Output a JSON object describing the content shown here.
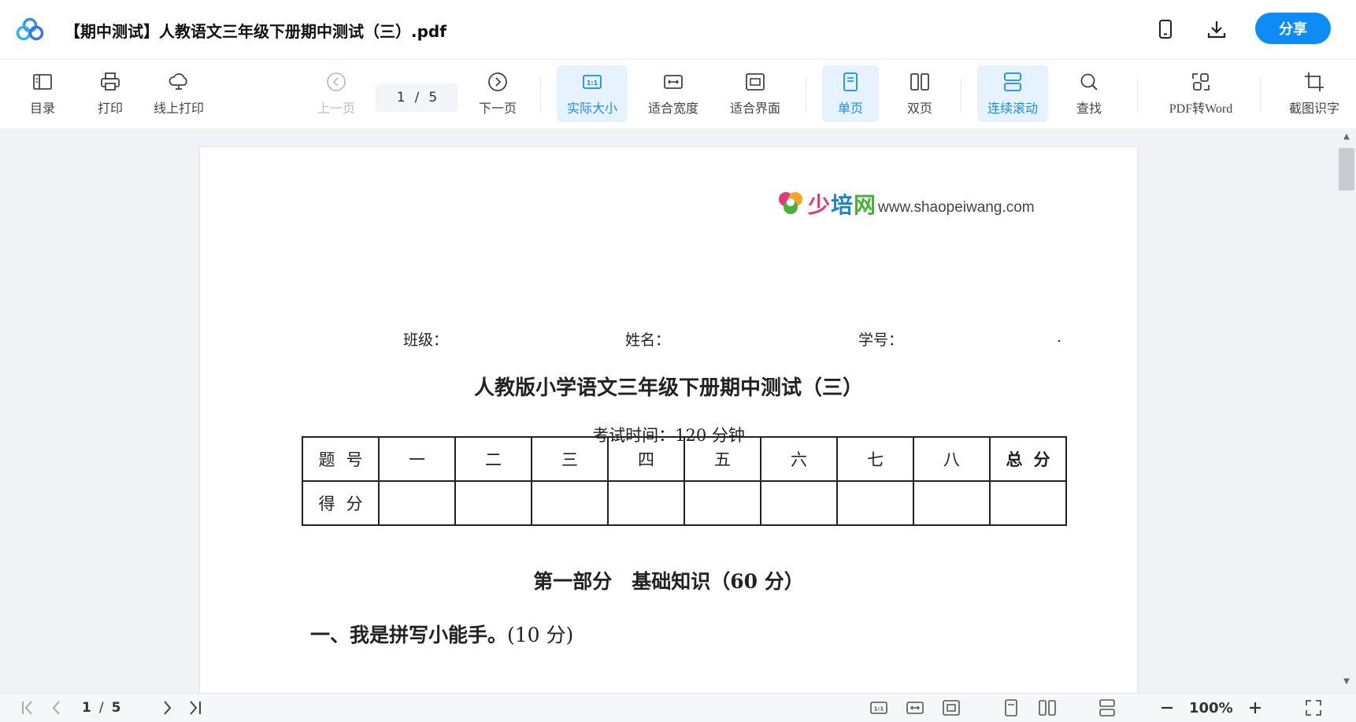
{
  "header": {
    "title": "【期中测试】人教语文三年级下册期中测试（三）.pdf",
    "share_label": "分享",
    "actions": [
      "phone-icon",
      "download-icon"
    ],
    "accent_color": "#0c8cf4"
  },
  "toolbar": {
    "toc": "目录",
    "print": "打印",
    "online_print": "线上打印",
    "prev_page": "上一页",
    "current_page": "1",
    "separator": "/",
    "total_pages": "5",
    "next_page": "下一页",
    "actual_size": "实际大小",
    "fit_width": "适合宽度",
    "fit_screen": "适合界面",
    "single_page": "单页",
    "double_page": "双页",
    "continuous_scroll": "连续滚动",
    "find": "查找",
    "pdf_to_word": "PDF转Word",
    "screenshot_ocr": "截图识字"
  },
  "document": {
    "logo_cn": [
      "少",
      "培",
      "网"
    ],
    "logo_url": "www.shaopeiwang.com",
    "class_label": "班级：",
    "name_label": "姓名：",
    "id_label": "学号：",
    "trailing_dot": ".",
    "exam_title": "人教版小学语文三年级下册期中测试（三）",
    "exam_time": "考试时间：120 分钟",
    "score_table": {
      "row1_head": "题号",
      "columns": [
        "一",
        "二",
        "三",
        "四",
        "五",
        "六",
        "七",
        "八"
      ],
      "total": "总分",
      "row2_head": "得分"
    },
    "section_title": "第一部分　基础知识（60 分）",
    "question_title": "一、我是拼写小能手。",
    "question_points": "(10 分)"
  },
  "statusbar": {
    "current_page": "1",
    "separator": "/",
    "total_pages": "5",
    "zoom": "100%"
  }
}
